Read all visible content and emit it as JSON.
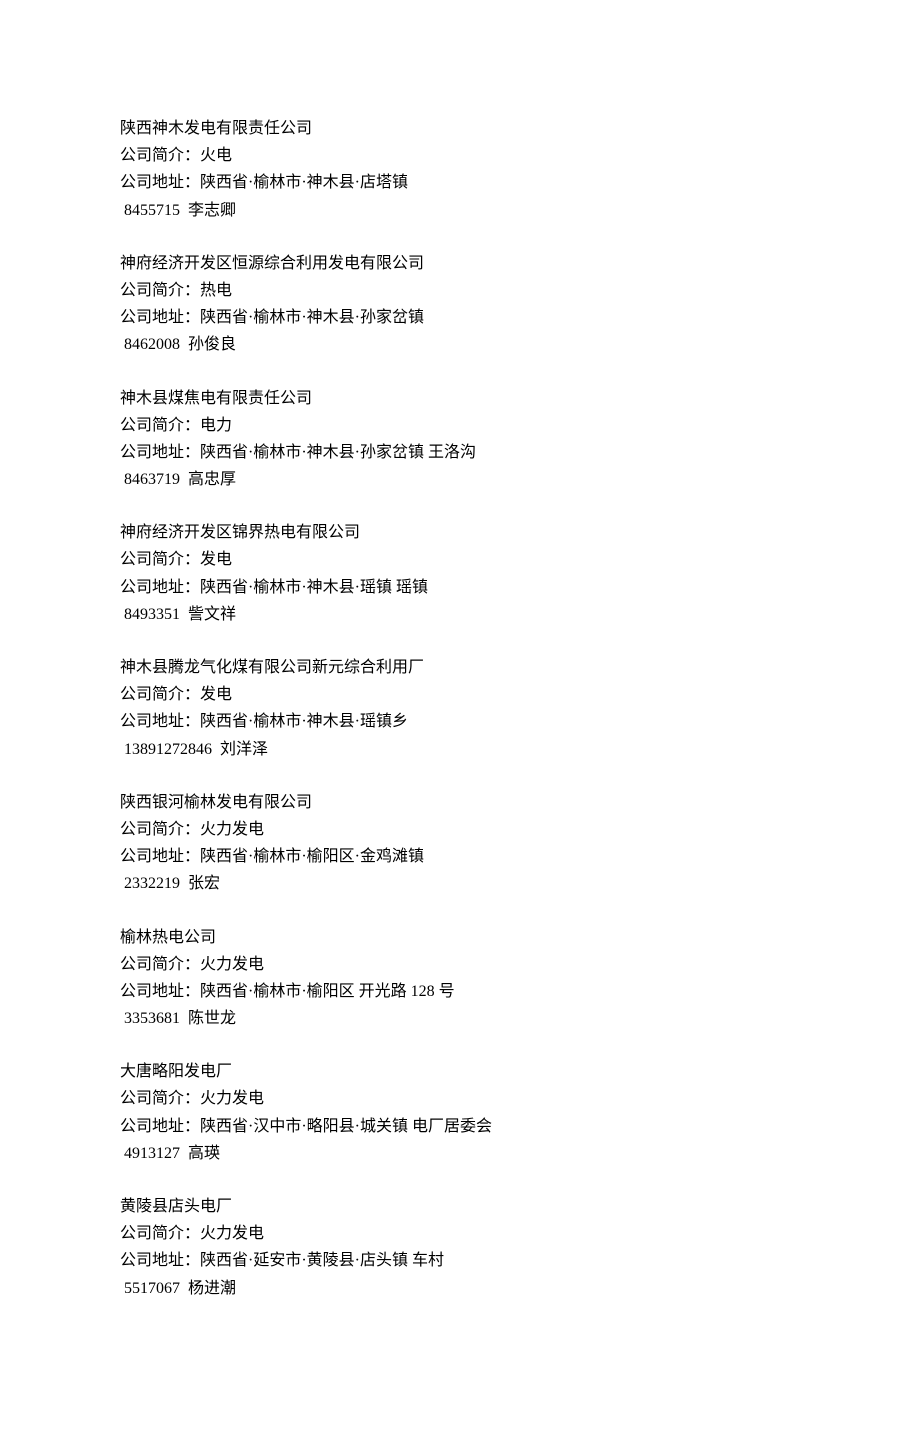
{
  "labels": {
    "intro_prefix": "公司简介：",
    "address_prefix": "公司地址："
  },
  "companies": [
    {
      "name": "陕西神木发电有限责任公司",
      "intro": "火电",
      "address": "陕西省·榆林市·神木县·店塔镇",
      "contact": " 8455715  李志卿"
    },
    {
      "name": "神府经济开发区恒源综合利用发电有限公司",
      "intro": "热电",
      "address": "陕西省·榆林市·神木县·孙家岔镇",
      "contact": " 8462008  孙俊良"
    },
    {
      "name": "神木县煤焦电有限责任公司",
      "intro": "电力",
      "address": "陕西省·榆林市·神木县·孙家岔镇 王洛沟",
      "contact": " 8463719  高忠厚"
    },
    {
      "name": "神府经济开发区锦界热电有限公司",
      "intro": "发电",
      "address": "陕西省·榆林市·神木县·瑶镇 瑶镇",
      "contact": " 8493351  訾文祥"
    },
    {
      "name": "神木县腾龙气化煤有限公司新元综合利用厂",
      "intro": "发电",
      "address": "陕西省·榆林市·神木县·瑶镇乡",
      "contact": " 13891272846  刘洋泽"
    },
    {
      "name": "陕西银河榆林发电有限公司",
      "intro": "火力发电",
      "address": "陕西省·榆林市·榆阳区·金鸡滩镇",
      "contact": " 2332219  张宏"
    },
    {
      "name": "榆林热电公司",
      "intro": "火力发电",
      "address": "陕西省·榆林市·榆阳区 开光路 128 号",
      "contact": " 3353681  陈世龙"
    },
    {
      "name": "大唐略阳发电厂",
      "intro": "火力发电",
      "address": "陕西省·汉中市·略阳县·城关镇 电厂居委会",
      "contact": " 4913127  高瑛"
    },
    {
      "name": "黄陵县店头电厂",
      "intro": "火力发电",
      "address": "陕西省·延安市·黄陵县·店头镇 车村",
      "contact": " 5517067  杨进潮"
    }
  ]
}
